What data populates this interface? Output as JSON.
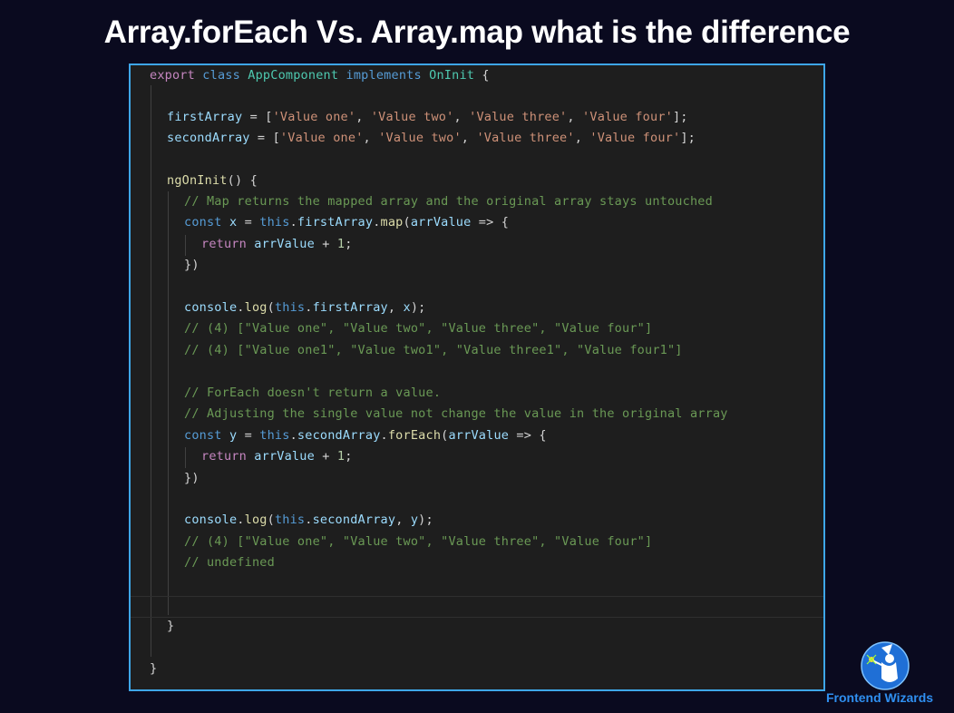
{
  "title": "Array.forEach Vs. Array.map what is the difference",
  "brand": "Frontend Wizards",
  "logo_icon": "wizard-icon",
  "code": {
    "l1": {
      "a": "export",
      "b": "class",
      "c": "AppComponent",
      "d": "implements",
      "e": "OnInit",
      "f": " {"
    },
    "l2": {
      "a": "firstArray",
      "b": " = [",
      "c": "'Value one'",
      "d": "'Value two'",
      "e": "'Value three'",
      "f": "'Value four'",
      "g": "];"
    },
    "l3": {
      "a": "secondArray",
      "b": " = [",
      "c": "'Value one'",
      "d": "'Value two'",
      "e": "'Value three'",
      "f": "'Value four'",
      "g": "];"
    },
    "l4": {
      "a": "ngOnInit",
      "b": "() {"
    },
    "l5": "// Map returns the mapped array and the original array stays untouched",
    "l6": {
      "a": "const",
      "b": "x",
      "c": " = ",
      "d": "this",
      "e": ".",
      "f": "firstArray",
      "g": ".",
      "h": "map",
      "i": "(",
      "j": "arrValue",
      "k": " => {"
    },
    "l7": {
      "a": "return",
      "b": "arrValue",
      "c": " + ",
      "d": "1",
      "e": ";"
    },
    "l8": "})",
    "l9": {
      "a": "console",
      "b": ".",
      "c": "log",
      "d": "(",
      "e": "this",
      "f": ".",
      "g": "firstArray",
      "h": ", ",
      "i": "x",
      "j": ");"
    },
    "l10": "// (4) [\"Value one\", \"Value two\", \"Value three\", \"Value four\"]",
    "l11": "// (4) [\"Value one1\", \"Value two1\", \"Value three1\", \"Value four1\"]",
    "l12": "// ForEach doesn't return a value.",
    "l13": "// Adjusting the single value not change the value in the original array",
    "l14": {
      "a": "const",
      "b": "y",
      "c": " = ",
      "d": "this",
      "e": ".",
      "f": "secondArray",
      "g": ".",
      "h": "forEach",
      "i": "(",
      "j": "arrValue",
      "k": " => {"
    },
    "l15": {
      "a": "return",
      "b": "arrValue",
      "c": " + ",
      "d": "1",
      "e": ";"
    },
    "l16": "})",
    "l17": {
      "a": "console",
      "b": ".",
      "c": "log",
      "d": "(",
      "e": "this",
      "f": ".",
      "g": "secondArray",
      "h": ", ",
      "i": "y",
      "j": ");"
    },
    "l18": "// (4) [\"Value one\", \"Value two\", \"Value three\", \"Value four\"]",
    "l19": "// undefined",
    "l20": "}",
    "l21": "}",
    "comma": ", "
  }
}
